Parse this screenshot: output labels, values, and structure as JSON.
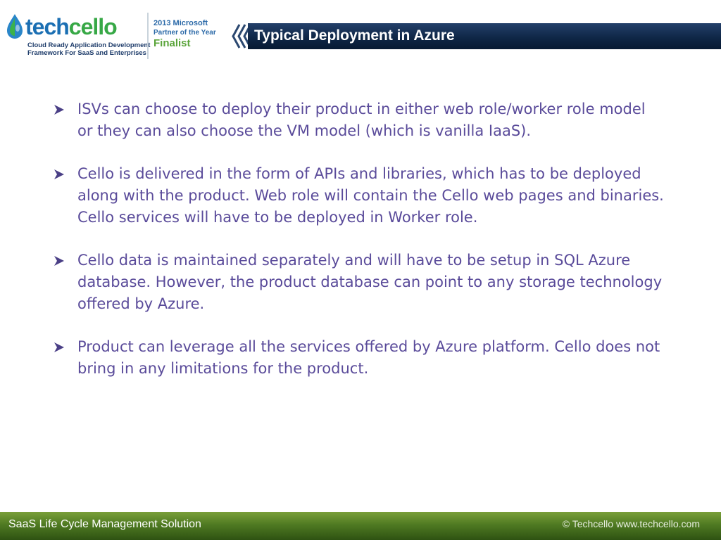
{
  "header": {
    "logo": {
      "word_part1": "tech",
      "word_part2": "cello",
      "tagline_line1": "Cloud Ready Application Development",
      "tagline_line2": "Framework For SaaS and Enterprises"
    },
    "award": {
      "line1": "2013 Microsoft",
      "line2": "Partner of the Year",
      "line3": "Finalist"
    },
    "title": "Typical Deployment in Azure"
  },
  "bullets": [
    {
      "icon": "arrow-bullet-icon",
      "text": "ISVs can choose to deploy their product in either web role/worker role model or they can also choose the VM model (which is vanilla IaaS)."
    },
    {
      "icon": "arrow-bullet-icon",
      "text": "Cello is delivered in the form of APIs and libraries, which has to be deployed along with the product. Web role will contain the Cello web pages and binaries. Cello services will have to be deployed in Worker role."
    },
    {
      "icon": "arrow-bullet-icon",
      "text": "Cello data is maintained separately and will have to be setup in SQL Azure database. However, the product database can point to any storage technology offered by Azure."
    },
    {
      "icon": "arrow-bullet-icon",
      "text": "Product can leverage all the services offered by Azure platform. Cello does not bring in any limitations for the product."
    }
  ],
  "footer": {
    "left": "SaaS Life Cycle Management Solution",
    "right": "© Techcello www.techcello.com"
  },
  "colors": {
    "title_bar": "#0f2747",
    "body_text": "#5a4b9a",
    "footer_bar": "#4f7a22",
    "logo_blue": "#1b6fb3",
    "logo_green": "#37a846"
  }
}
